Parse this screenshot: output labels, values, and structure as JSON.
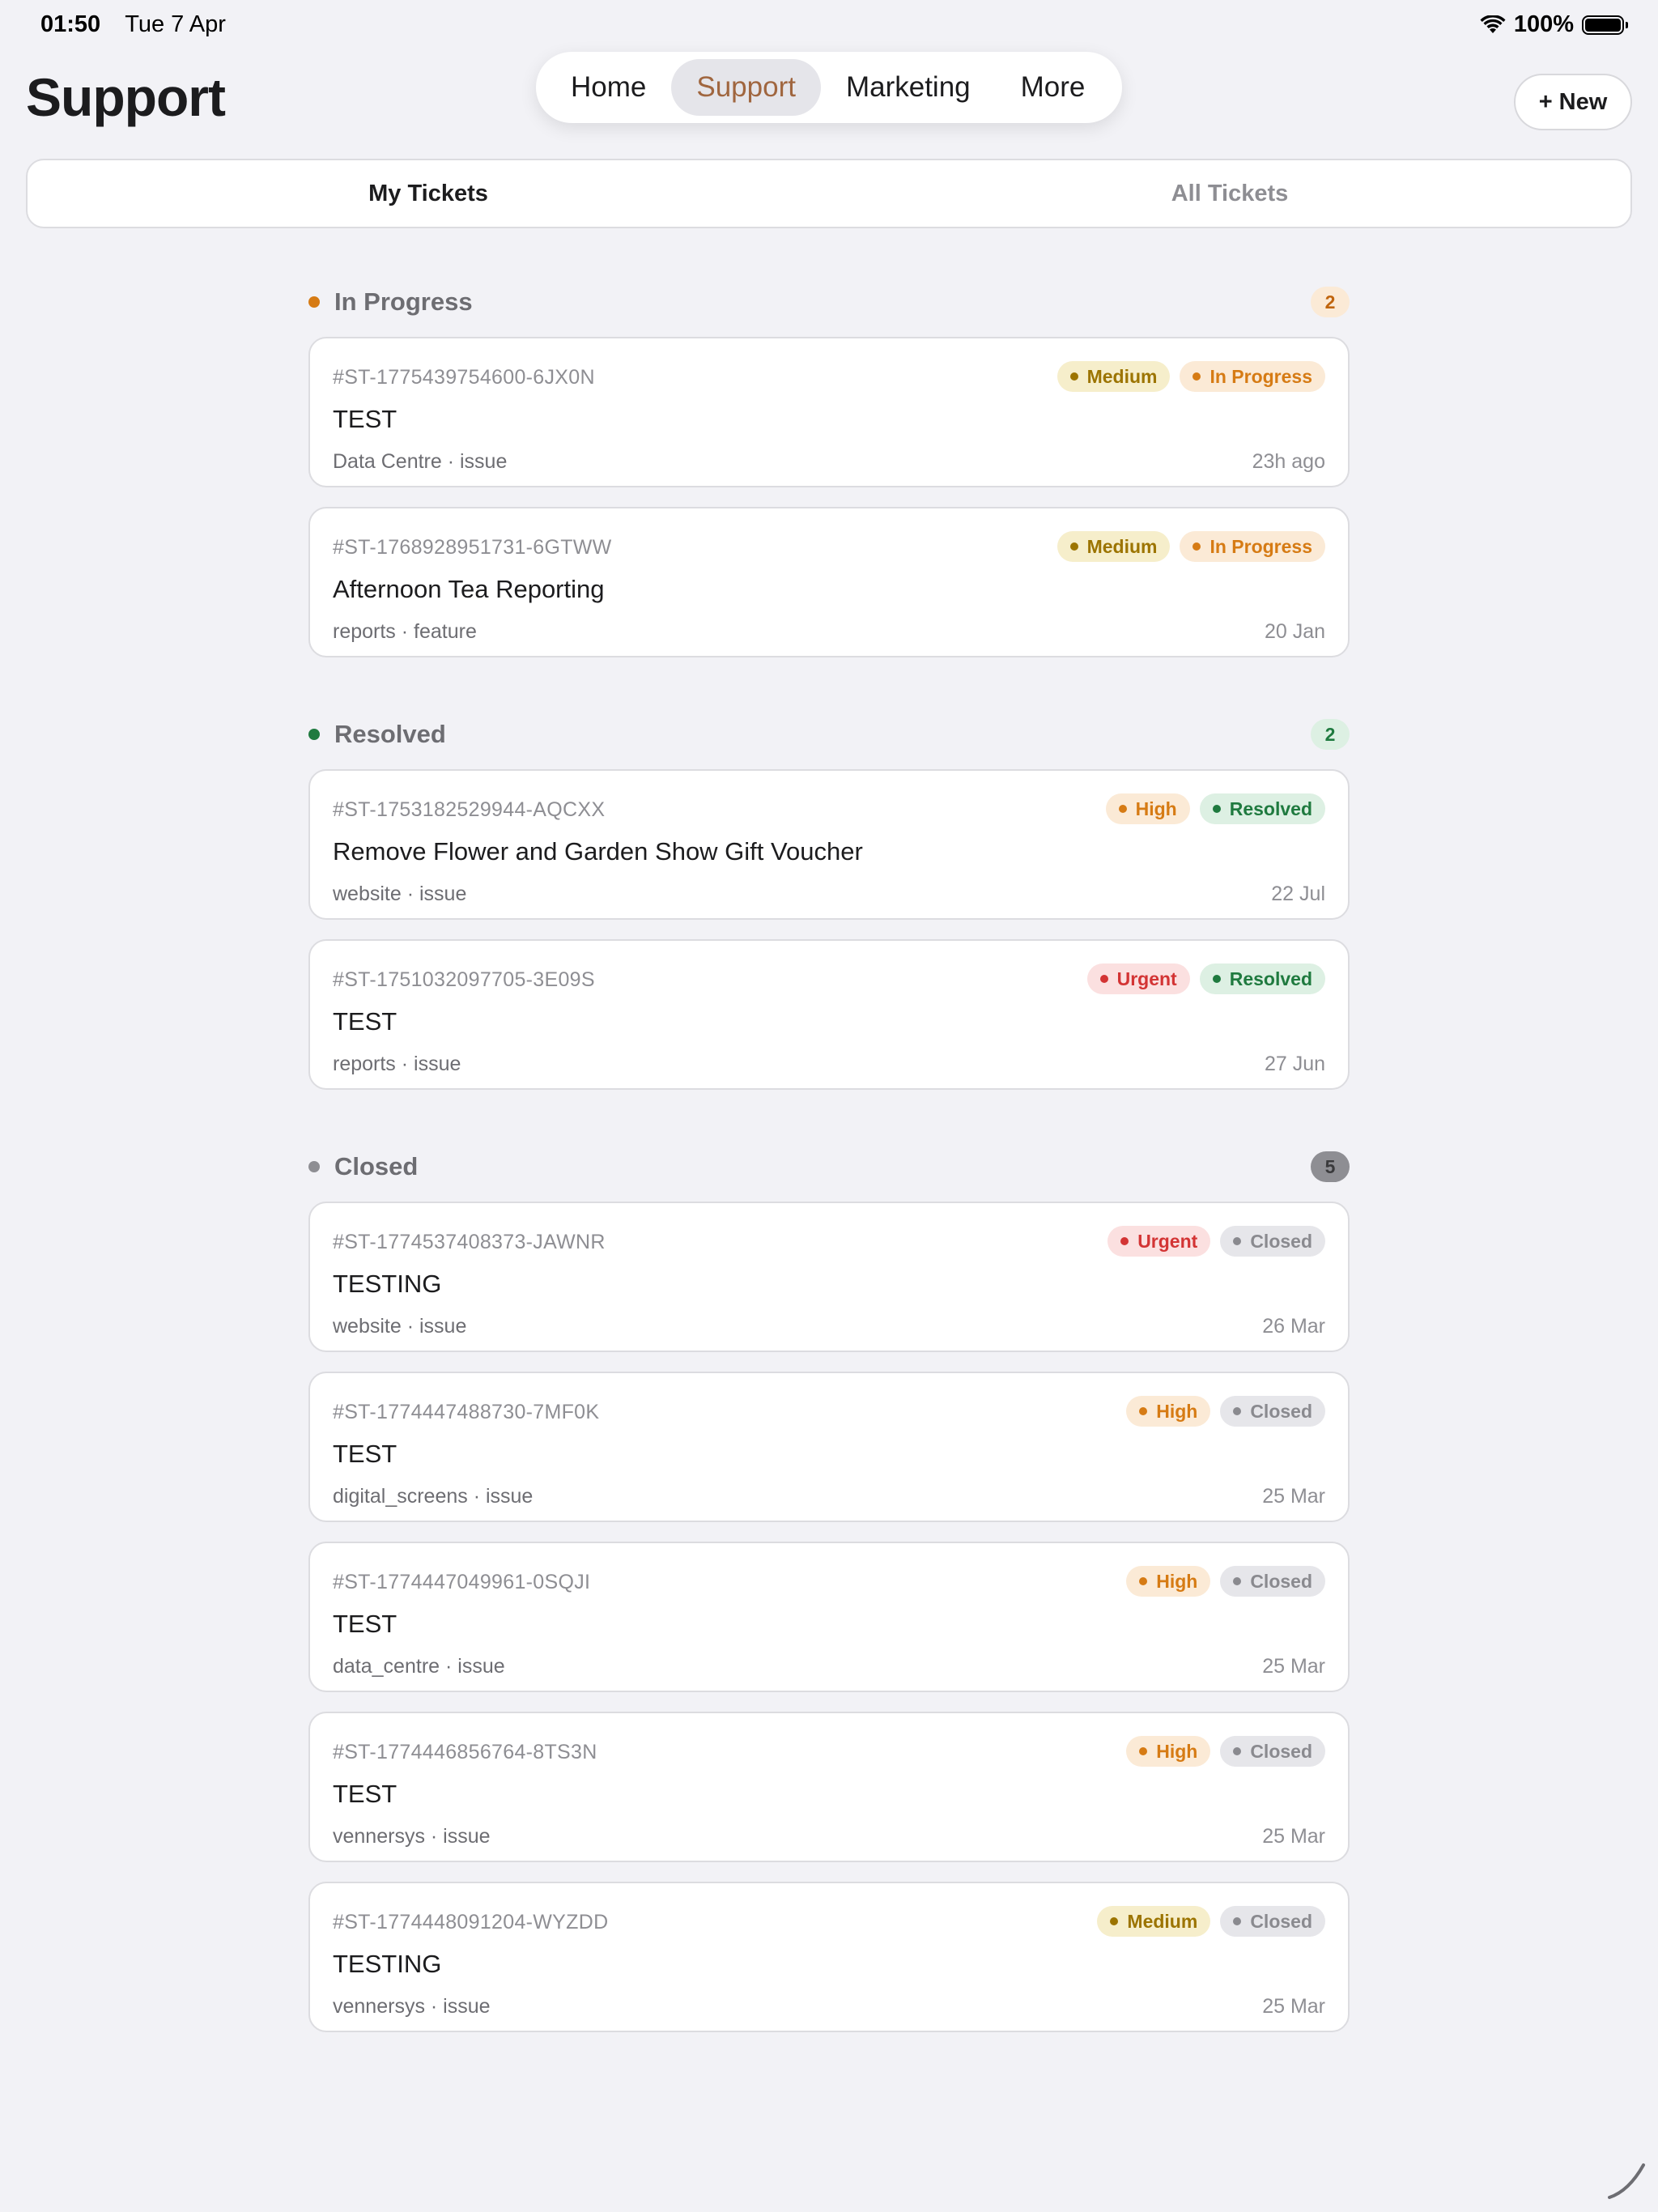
{
  "status_bar": {
    "time": "01:50",
    "date": "Tue 7 Apr",
    "battery": "100%"
  },
  "header": {
    "title": "Support",
    "nav": [
      "Home",
      "Support",
      "Marketing",
      "More"
    ],
    "active_nav": 1,
    "new_label": "+ New"
  },
  "segments": {
    "my": "My Tickets",
    "all": "All Tickets"
  },
  "colors": {
    "medium_bg": "#f6eecb",
    "medium_fg": "#9c7400",
    "inprogress_bg": "#fbead6",
    "inprogress_fg": "#d67b14",
    "high_bg": "#fbead6",
    "high_fg": "#d67b14",
    "urgent_bg": "#fbe0e0",
    "urgent_fg": "#d33434",
    "resolved_bg": "#ddf0e3",
    "resolved_fg": "#1f7a3f",
    "closed_bg": "#e6e6ea",
    "closed_fg": "#8a8a8f"
  },
  "sections": [
    {
      "title": "In Progress",
      "count": "2",
      "dot": "#d67b14",
      "badge_bg": "#fbead6",
      "badge_fg": "#c0650e",
      "tickets": [
        {
          "id": "#ST-1775439754600-6JX0N",
          "title": "TEST",
          "meta": "Data Centre · issue",
          "time": "23h ago",
          "tags": [
            {
              "label": "Medium",
              "kind": "medium"
            },
            {
              "label": "In Progress",
              "kind": "inprogress"
            }
          ]
        },
        {
          "id": "#ST-1768928951731-6GTWW",
          "title": "Afternoon Tea Reporting",
          "meta": "reports · feature",
          "time": "20 Jan",
          "tags": [
            {
              "label": "Medium",
              "kind": "medium"
            },
            {
              "label": "In Progress",
              "kind": "inprogress"
            }
          ]
        }
      ]
    },
    {
      "title": "Resolved",
      "count": "2",
      "dot": "#1f7a3f",
      "badge_bg": "#ddf0e3",
      "badge_fg": "#1f7a3f",
      "tickets": [
        {
          "id": "#ST-1753182529944-AQCXX",
          "title": "Remove Flower and Garden Show Gift Voucher",
          "meta": "website · issue",
          "time": "22 Jul",
          "tags": [
            {
              "label": "High",
              "kind": "high"
            },
            {
              "label": "Resolved",
              "kind": "resolved"
            }
          ]
        },
        {
          "id": "#ST-1751032097705-3E09S",
          "title": "TEST",
          "meta": "reports · issue",
          "time": "27 Jun",
          "tags": [
            {
              "label": "Urgent",
              "kind": "urgent"
            },
            {
              "label": "Resolved",
              "kind": "resolved"
            }
          ]
        }
      ]
    },
    {
      "title": "Closed",
      "count": "5",
      "dot": "#8e8e93",
      "badge_bg": "#8e8e93",
      "badge_fg": "#3a3a3c",
      "tickets": [
        {
          "id": "#ST-1774537408373-JAWNR",
          "title": "TESTING",
          "meta": "website · issue",
          "time": "26 Mar",
          "tags": [
            {
              "label": "Urgent",
              "kind": "urgent"
            },
            {
              "label": "Closed",
              "kind": "closed"
            }
          ]
        },
        {
          "id": "#ST-1774447488730-7MF0K",
          "title": "TEST",
          "meta": "digital_screens · issue",
          "time": "25 Mar",
          "tags": [
            {
              "label": "High",
              "kind": "high"
            },
            {
              "label": "Closed",
              "kind": "closed"
            }
          ]
        },
        {
          "id": "#ST-1774447049961-0SQJI",
          "title": "TEST",
          "meta": "data_centre · issue",
          "time": "25 Mar",
          "tags": [
            {
              "label": "High",
              "kind": "high"
            },
            {
              "label": "Closed",
              "kind": "closed"
            }
          ]
        },
        {
          "id": "#ST-1774446856764-8TS3N",
          "title": "TEST",
          "meta": "vennersys · issue",
          "time": "25 Mar",
          "tags": [
            {
              "label": "High",
              "kind": "high"
            },
            {
              "label": "Closed",
              "kind": "closed"
            }
          ]
        },
        {
          "id": "#ST-1774448091204-WYZDD",
          "title": "TESTING",
          "meta": "vennersys · issue",
          "time": "25 Mar",
          "tags": [
            {
              "label": "Medium",
              "kind": "medium"
            },
            {
              "label": "Closed",
              "kind": "closed"
            }
          ]
        }
      ]
    }
  ]
}
